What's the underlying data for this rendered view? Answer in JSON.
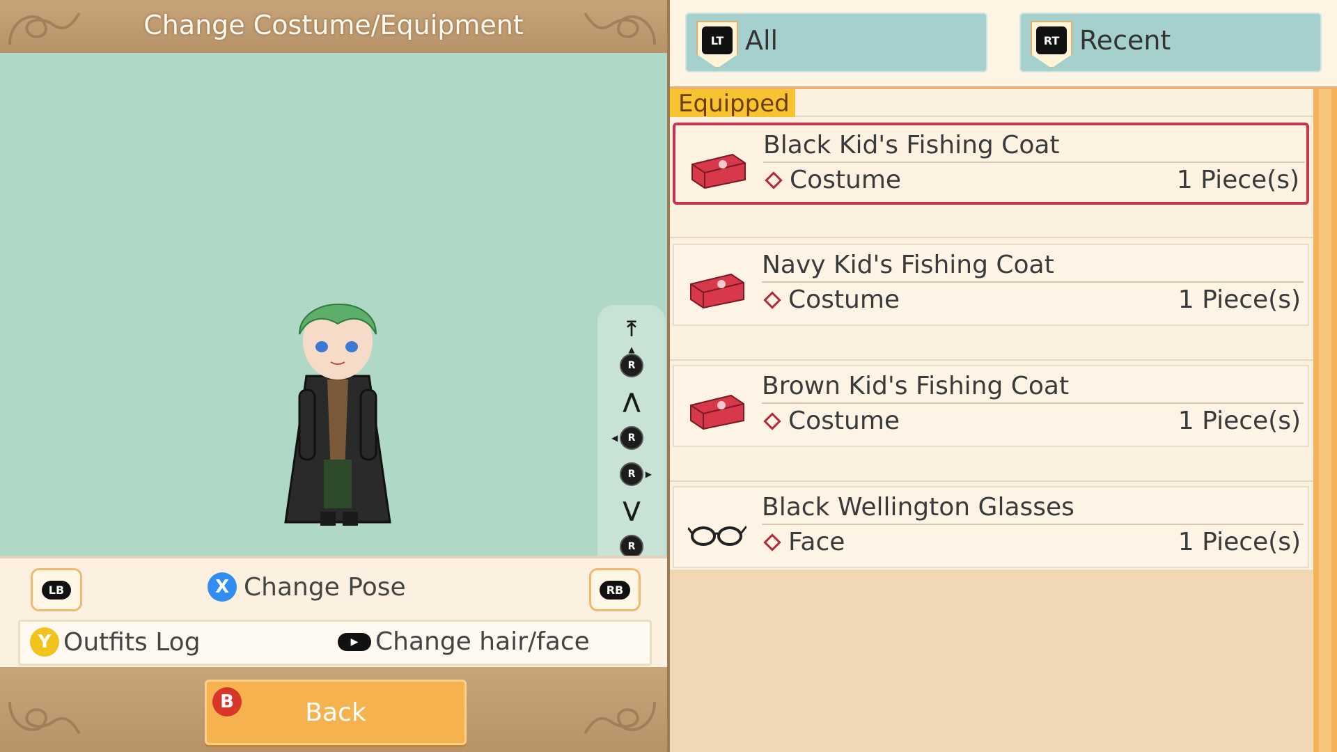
{
  "header": {
    "title": "Change Costume/Equipment"
  },
  "preview": {
    "nav": {
      "top_glyph": "⤒",
      "up_fast_glyph": "⋀",
      "down_fast_glyph": "⋁",
      "bottom_glyph": "⤓",
      "stick_label": "R"
    }
  },
  "pose_bar": {
    "lb_label": "LB",
    "rb_label": "RB",
    "x_label": "X",
    "change_pose_label": "Change Pose",
    "y_label": "Y",
    "outfits_log_label": "Outfits Log",
    "change_hair_face_label": "Change hair/face"
  },
  "footer": {
    "b_label": "B",
    "back_label": "Back"
  },
  "tabs": [
    {
      "badge": "LT",
      "label": "All"
    },
    {
      "badge": "RT",
      "label": "Recent"
    }
  ],
  "list": {
    "section_label": "Equipped",
    "items": [
      {
        "name": "Black Kid's Fishing Coat",
        "category": "Costume",
        "count": "1 Piece(s)",
        "icon": "costume-case-icon",
        "selected": true
      },
      {
        "name": "Navy Kid's Fishing Coat",
        "category": "Costume",
        "count": "1 Piece(s)",
        "icon": "costume-case-icon",
        "selected": false
      },
      {
        "name": "Brown Kid's Fishing Coat",
        "category": "Costume",
        "count": "1 Piece(s)",
        "icon": "costume-case-icon",
        "selected": false
      },
      {
        "name": "Black Wellington Glasses",
        "category": "Face",
        "count": "1 Piece(s)",
        "icon": "glasses-icon",
        "selected": false
      }
    ]
  },
  "colors": {
    "selected_border": "#c8344e",
    "equipped_tag": "#f7c331",
    "back_button": "#f5b24e",
    "preview_bg": "#b0d8c6",
    "tab_bg": "#a6d0ce"
  }
}
